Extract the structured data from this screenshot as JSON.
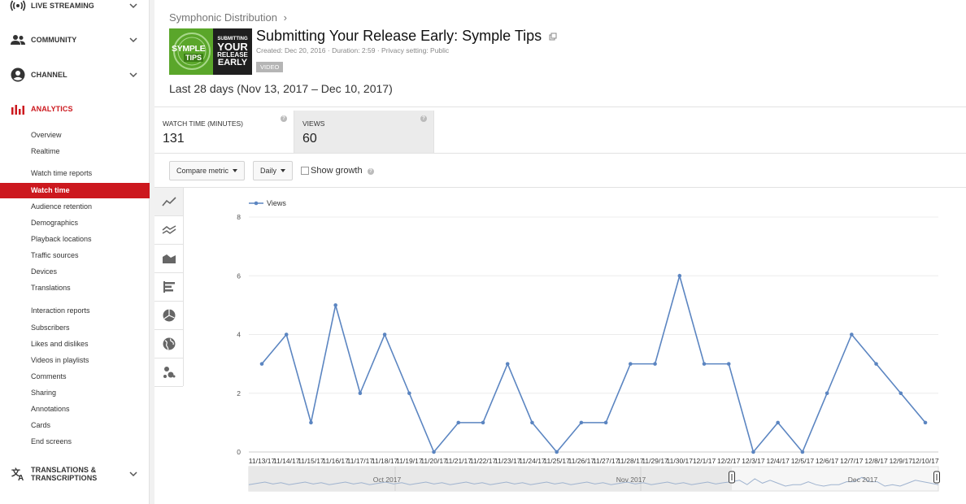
{
  "sidebar": {
    "live_streaming": "LIVE STREAMING",
    "community": "COMMUNITY",
    "channel": "CHANNEL",
    "analytics": "ANALYTICS",
    "translations": "TRANSLATIONS & TRANSCRIPTIONS",
    "items": [
      {
        "label": "Overview"
      },
      {
        "label": "Realtime"
      },
      {
        "label": "Watch time reports"
      },
      {
        "label": "Watch time"
      },
      {
        "label": "Audience retention"
      },
      {
        "label": "Demographics"
      },
      {
        "label": "Playback locations"
      },
      {
        "label": "Traffic sources"
      },
      {
        "label": "Devices"
      },
      {
        "label": "Translations"
      },
      {
        "label": "Interaction reports"
      },
      {
        "label": "Subscribers"
      },
      {
        "label": "Likes and dislikes"
      },
      {
        "label": "Videos in playlists"
      },
      {
        "label": "Comments"
      },
      {
        "label": "Sharing"
      },
      {
        "label": "Annotations"
      },
      {
        "label": "Cards"
      },
      {
        "label": "End screens"
      }
    ]
  },
  "header": {
    "breadcrumb": "Symphonic Distribution",
    "breadcrumb_sep": "›",
    "video_title": "Submitting Your Release Early: Symple Tips",
    "meta": "Created: Dec 20, 2016 · Duration: 2:59 · Privacy setting: Public",
    "badge": "VIDEO",
    "thumb": {
      "left_top": "SYMPLE",
      "left_bottom": "TIPS",
      "r1": "SUBMITTING",
      "r2": "YOUR",
      "r3": "RELEASE",
      "r4": "EARLY"
    },
    "date_range": "Last 28 days (Nov 13, 2017 – Dec 10, 2017)"
  },
  "metrics": [
    {
      "label": "WATCH TIME (MINUTES)",
      "value": "131"
    },
    {
      "label": "VIEWS",
      "value": "60"
    }
  ],
  "controls": {
    "compare": "Compare metric",
    "interval": "Daily",
    "show_growth": "Show growth"
  },
  "colors": {
    "accent": "#cc181e",
    "series": "#5b85c1"
  },
  "chart_data": {
    "type": "line",
    "series": [
      {
        "name": "Views",
        "values": [
          3,
          4,
          1,
          5,
          2,
          4,
          2,
          0,
          1,
          1,
          3,
          1,
          0,
          1,
          1,
          3,
          3,
          6,
          3,
          3,
          0,
          1,
          0,
          2,
          4,
          3,
          2,
          1
        ]
      }
    ],
    "x": [
      "11/13/17",
      "11/14/17",
      "11/15/17",
      "11/16/17",
      "11/17/17",
      "11/18/17",
      "11/19/17",
      "11/20/17",
      "11/21/17",
      "11/22/17",
      "11/23/17",
      "11/24/17",
      "11/25/17",
      "11/26/17",
      "11/27/17",
      "11/28/17",
      "11/29/17",
      "11/30/17",
      "12/1/17",
      "12/2/17",
      "12/3/17",
      "12/4/17",
      "12/5/17",
      "12/6/17",
      "12/7/17",
      "12/8/17",
      "12/9/17",
      "12/10/17"
    ],
    "ylim": [
      0,
      8
    ],
    "yticks": [
      0,
      2,
      4,
      6,
      8
    ],
    "legend": "top-left",
    "grid": true,
    "navigator_labels": [
      "Oct 2017",
      "Nov 2017",
      "Dec 2017"
    ]
  }
}
